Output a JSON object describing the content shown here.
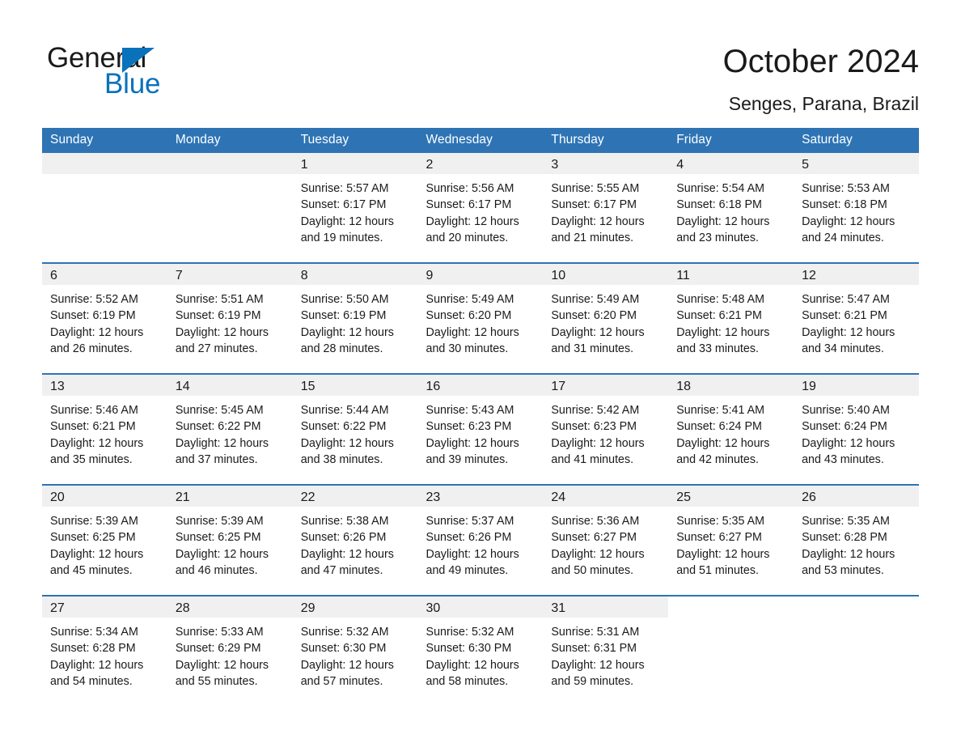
{
  "logo": {
    "word1": "General",
    "word2": "Blue",
    "triangle_color": "#0a72bb",
    "text_color": "#1a1a1a"
  },
  "header": {
    "title": "October 2024",
    "subtitle": "Senges, Parana, Brazil"
  },
  "theme": {
    "header_blue": "#2e74b5",
    "day_band_gray": "#f0f0f0",
    "text": "#1a1a1a",
    "page_background": "#ffffff"
  },
  "weekday_headers": [
    "Sunday",
    "Monday",
    "Tuesday",
    "Wednesday",
    "Thursday",
    "Friday",
    "Saturday"
  ],
  "calendar_data": {
    "month": "October",
    "year": "2024",
    "location": "Senges, Parana, Brazil",
    "first_day_column": "Tuesday",
    "days_in_month": 31,
    "weeks": [
      [
        {
          "day": "",
          "empty": true
        },
        {
          "day": "",
          "empty": true
        },
        {
          "day": "1",
          "sunrise": "Sunrise: 5:57 AM",
          "sunset": "Sunset: 6:17 PM",
          "daylight_l1": "Daylight: 12 hours",
          "daylight_l2": "and 19 minutes."
        },
        {
          "day": "2",
          "sunrise": "Sunrise: 5:56 AM",
          "sunset": "Sunset: 6:17 PM",
          "daylight_l1": "Daylight: 12 hours",
          "daylight_l2": "and 20 minutes."
        },
        {
          "day": "3",
          "sunrise": "Sunrise: 5:55 AM",
          "sunset": "Sunset: 6:17 PM",
          "daylight_l1": "Daylight: 12 hours",
          "daylight_l2": "and 21 minutes."
        },
        {
          "day": "4",
          "sunrise": "Sunrise: 5:54 AM",
          "sunset": "Sunset: 6:18 PM",
          "daylight_l1": "Daylight: 12 hours",
          "daylight_l2": "and 23 minutes."
        },
        {
          "day": "5",
          "sunrise": "Sunrise: 5:53 AM",
          "sunset": "Sunset: 6:18 PM",
          "daylight_l1": "Daylight: 12 hours",
          "daylight_l2": "and 24 minutes."
        }
      ],
      [
        {
          "day": "6",
          "sunrise": "Sunrise: 5:52 AM",
          "sunset": "Sunset: 6:19 PM",
          "daylight_l1": "Daylight: 12 hours",
          "daylight_l2": "and 26 minutes."
        },
        {
          "day": "7",
          "sunrise": "Sunrise: 5:51 AM",
          "sunset": "Sunset: 6:19 PM",
          "daylight_l1": "Daylight: 12 hours",
          "daylight_l2": "and 27 minutes."
        },
        {
          "day": "8",
          "sunrise": "Sunrise: 5:50 AM",
          "sunset": "Sunset: 6:19 PM",
          "daylight_l1": "Daylight: 12 hours",
          "daylight_l2": "and 28 minutes."
        },
        {
          "day": "9",
          "sunrise": "Sunrise: 5:49 AM",
          "sunset": "Sunset: 6:20 PM",
          "daylight_l1": "Daylight: 12 hours",
          "daylight_l2": "and 30 minutes."
        },
        {
          "day": "10",
          "sunrise": "Sunrise: 5:49 AM",
          "sunset": "Sunset: 6:20 PM",
          "daylight_l1": "Daylight: 12 hours",
          "daylight_l2": "and 31 minutes."
        },
        {
          "day": "11",
          "sunrise": "Sunrise: 5:48 AM",
          "sunset": "Sunset: 6:21 PM",
          "daylight_l1": "Daylight: 12 hours",
          "daylight_l2": "and 33 minutes."
        },
        {
          "day": "12",
          "sunrise": "Sunrise: 5:47 AM",
          "sunset": "Sunset: 6:21 PM",
          "daylight_l1": "Daylight: 12 hours",
          "daylight_l2": "and 34 minutes."
        }
      ],
      [
        {
          "day": "13",
          "sunrise": "Sunrise: 5:46 AM",
          "sunset": "Sunset: 6:21 PM",
          "daylight_l1": "Daylight: 12 hours",
          "daylight_l2": "and 35 minutes."
        },
        {
          "day": "14",
          "sunrise": "Sunrise: 5:45 AM",
          "sunset": "Sunset: 6:22 PM",
          "daylight_l1": "Daylight: 12 hours",
          "daylight_l2": "and 37 minutes."
        },
        {
          "day": "15",
          "sunrise": "Sunrise: 5:44 AM",
          "sunset": "Sunset: 6:22 PM",
          "daylight_l1": "Daylight: 12 hours",
          "daylight_l2": "and 38 minutes."
        },
        {
          "day": "16",
          "sunrise": "Sunrise: 5:43 AM",
          "sunset": "Sunset: 6:23 PM",
          "daylight_l1": "Daylight: 12 hours",
          "daylight_l2": "and 39 minutes."
        },
        {
          "day": "17",
          "sunrise": "Sunrise: 5:42 AM",
          "sunset": "Sunset: 6:23 PM",
          "daylight_l1": "Daylight: 12 hours",
          "daylight_l2": "and 41 minutes."
        },
        {
          "day": "18",
          "sunrise": "Sunrise: 5:41 AM",
          "sunset": "Sunset: 6:24 PM",
          "daylight_l1": "Daylight: 12 hours",
          "daylight_l2": "and 42 minutes."
        },
        {
          "day": "19",
          "sunrise": "Sunrise: 5:40 AM",
          "sunset": "Sunset: 6:24 PM",
          "daylight_l1": "Daylight: 12 hours",
          "daylight_l2": "and 43 minutes."
        }
      ],
      [
        {
          "day": "20",
          "sunrise": "Sunrise: 5:39 AM",
          "sunset": "Sunset: 6:25 PM",
          "daylight_l1": "Daylight: 12 hours",
          "daylight_l2": "and 45 minutes."
        },
        {
          "day": "21",
          "sunrise": "Sunrise: 5:39 AM",
          "sunset": "Sunset: 6:25 PM",
          "daylight_l1": "Daylight: 12 hours",
          "daylight_l2": "and 46 minutes."
        },
        {
          "day": "22",
          "sunrise": "Sunrise: 5:38 AM",
          "sunset": "Sunset: 6:26 PM",
          "daylight_l1": "Daylight: 12 hours",
          "daylight_l2": "and 47 minutes."
        },
        {
          "day": "23",
          "sunrise": "Sunrise: 5:37 AM",
          "sunset": "Sunset: 6:26 PM",
          "daylight_l1": "Daylight: 12 hours",
          "daylight_l2": "and 49 minutes."
        },
        {
          "day": "24",
          "sunrise": "Sunrise: 5:36 AM",
          "sunset": "Sunset: 6:27 PM",
          "daylight_l1": "Daylight: 12 hours",
          "daylight_l2": "and 50 minutes."
        },
        {
          "day": "25",
          "sunrise": "Sunrise: 5:35 AM",
          "sunset": "Sunset: 6:27 PM",
          "daylight_l1": "Daylight: 12 hours",
          "daylight_l2": "and 51 minutes."
        },
        {
          "day": "26",
          "sunrise": "Sunrise: 5:35 AM",
          "sunset": "Sunset: 6:28 PM",
          "daylight_l1": "Daylight: 12 hours",
          "daylight_l2": "and 53 minutes."
        }
      ],
      [
        {
          "day": "27",
          "sunrise": "Sunrise: 5:34 AM",
          "sunset": "Sunset: 6:28 PM",
          "daylight_l1": "Daylight: 12 hours",
          "daylight_l2": "and 54 minutes."
        },
        {
          "day": "28",
          "sunrise": "Sunrise: 5:33 AM",
          "sunset": "Sunset: 6:29 PM",
          "daylight_l1": "Daylight: 12 hours",
          "daylight_l2": "and 55 minutes."
        },
        {
          "day": "29",
          "sunrise": "Sunrise: 5:32 AM",
          "sunset": "Sunset: 6:30 PM",
          "daylight_l1": "Daylight: 12 hours",
          "daylight_l2": "and 57 minutes."
        },
        {
          "day": "30",
          "sunrise": "Sunrise: 5:32 AM",
          "sunset": "Sunset: 6:30 PM",
          "daylight_l1": "Daylight: 12 hours",
          "daylight_l2": "and 58 minutes."
        },
        {
          "day": "31",
          "sunrise": "Sunrise: 5:31 AM",
          "sunset": "Sunset: 6:31 PM",
          "daylight_l1": "Daylight: 12 hours",
          "daylight_l2": "and 59 minutes."
        },
        {
          "day": "",
          "empty": true,
          "no_band": true
        },
        {
          "day": "",
          "empty": true,
          "no_band": true
        }
      ]
    ]
  }
}
